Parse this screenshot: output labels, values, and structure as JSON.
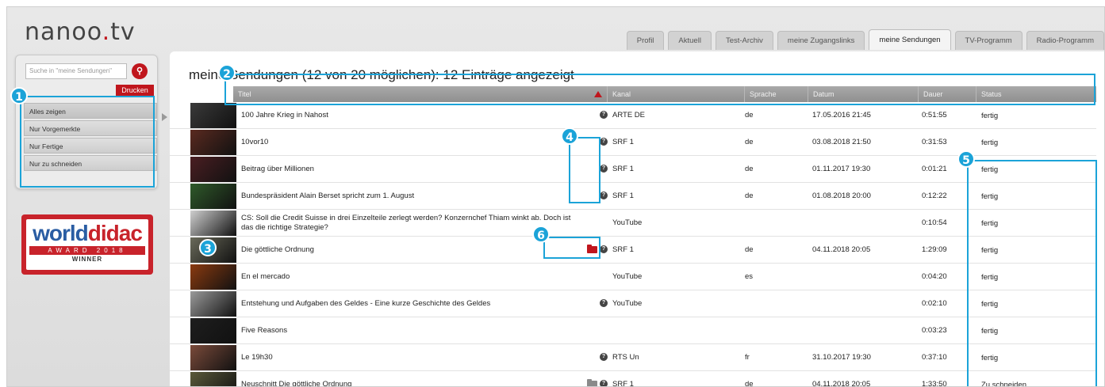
{
  "logo": {
    "pre": "nanoo",
    "dot": ".",
    "post": "tv"
  },
  "tabs": [
    "Profil",
    "Aktuell",
    "Test-Archiv",
    "meine Zugangslinks",
    "meine Sendungen",
    "TV-Programm",
    "Radio-Programm"
  ],
  "active_tab": "meine Sendungen",
  "sidebar": {
    "search_placeholder": "Suche in \"meine Sendungen\"",
    "search_icon": "search-icon",
    "print_label": "Drucken",
    "filters": [
      "Alles zeigen",
      "Nur Vorgemerkte",
      "Nur Fertige",
      "Nur zu schneiden"
    ]
  },
  "award": {
    "word1": "world",
    "word2": "didac",
    "sub": "AWARD 2018",
    "winner": "WINNER"
  },
  "page_title": "meine Sendungen (12 von 20 möglichen): 12 Einträge angezeigt",
  "columns": [
    "Titel",
    "Kanal",
    "Sprache",
    "Datum",
    "Dauer",
    "Status"
  ],
  "rows": [
    {
      "title": "100 Jahre Krieg in Nahost",
      "kanal": "ARTE DE",
      "lang": "de",
      "date": "17.05.2016 21:45",
      "dur": "0:51:55",
      "status": "fertig",
      "info": true,
      "folder": "",
      "thumb": "#3a3a3a"
    },
    {
      "title": "10vor10",
      "kanal": "SRF 1",
      "lang": "de",
      "date": "03.08.2018 21:50",
      "dur": "0:31:53",
      "status": "fertig",
      "info": true,
      "folder": "",
      "thumb": "#5a2a20"
    },
    {
      "title": "Beitrag über Millionen",
      "kanal": "SRF 1",
      "lang": "de",
      "date": "01.11.2017 19:30",
      "dur": "0:01:21",
      "status": "fertig",
      "info": true,
      "folder": "",
      "thumb": "#4a1e22"
    },
    {
      "title": "Bundespräsident Alain Berset spricht zum 1. August",
      "kanal": "SRF 1",
      "lang": "de",
      "date": "01.08.2018 20:00",
      "dur": "0:12:22",
      "status": "fertig",
      "info": true,
      "folder": "",
      "thumb": "#2f5a2a"
    },
    {
      "title": "CS: Soll die Credit Suisse in drei Einzelteile zerlegt werden? Konzernchef Thiam winkt ab. Doch ist das die richtige Strategie?",
      "kanal": "YouTube",
      "lang": "",
      "date": "",
      "dur": "0:10:54",
      "status": "fertig",
      "info": false,
      "folder": "",
      "thumb": "#cfcfcf"
    },
    {
      "title": "Die göttliche Ordnung",
      "kanal": "SRF 1",
      "lang": "de",
      "date": "04.11.2018 20:05",
      "dur": "1:29:09",
      "status": "fertig",
      "info": true,
      "folder": "red",
      "thumb": "#6a6a5a"
    },
    {
      "title": "En el mercado",
      "kanal": "YouTube",
      "lang": "es",
      "date": "",
      "dur": "0:04:20",
      "status": "fertig",
      "info": false,
      "folder": "",
      "thumb": "#8a3a10"
    },
    {
      "title": "Entstehung und Aufgaben des Geldes - Eine kurze Geschichte des Geldes",
      "kanal": "YouTube",
      "lang": "",
      "date": "",
      "dur": "0:02:10",
      "status": "fertig",
      "info": true,
      "folder": "",
      "thumb": "#9a9a9a"
    },
    {
      "title": "Five Reasons",
      "kanal": "",
      "lang": "",
      "date": "",
      "dur": "0:03:23",
      "status": "fertig",
      "info": false,
      "folder": "",
      "thumb": "#1e1e1e"
    },
    {
      "title": "Le 19h30",
      "kanal": "RTS Un",
      "lang": "fr",
      "date": "31.10.2017 19:30",
      "dur": "0:37:10",
      "status": "fertig",
      "info": true,
      "folder": "",
      "thumb": "#7a4a3a"
    },
    {
      "title": "Neuschnitt Die göttliche Ordnung",
      "kanal": "SRF 1",
      "lang": "de",
      "date": "04.11.2018 20:05",
      "dur": "1:33:50",
      "status": "Zu schneiden",
      "info": true,
      "folder": "grey",
      "thumb": "#5a5a3a"
    }
  ],
  "callouts": [
    "1",
    "2",
    "3",
    "4",
    "5",
    "6"
  ],
  "colors": {
    "accent": "#c0161d",
    "callout": "#1ba3d8",
    "header": "#9a9a9a"
  }
}
